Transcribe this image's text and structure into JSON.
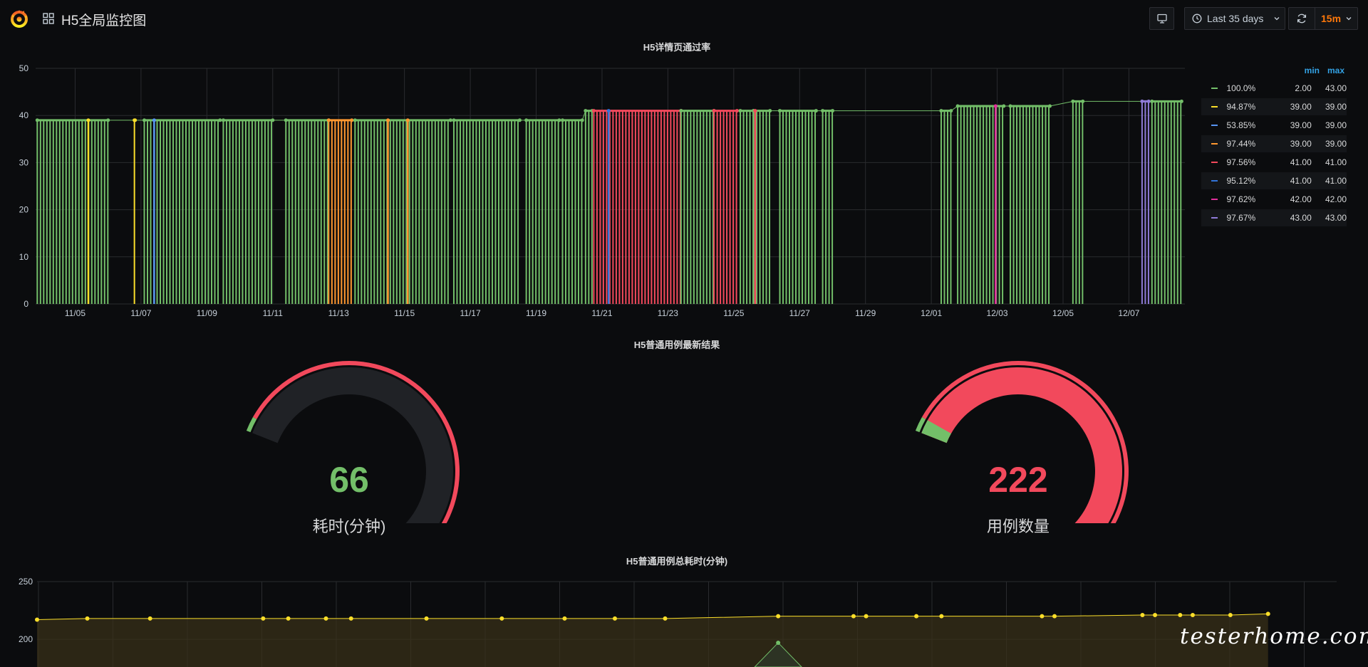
{
  "dashboard": {
    "title": "H5全局监控图"
  },
  "toolbar": {
    "time_range_label": "Last 35 days",
    "refresh_interval": "15m"
  },
  "panels": {
    "pass_rate": {
      "title": "H5详情页通过率",
      "legend": {
        "col_min": "min",
        "col_max": "max",
        "rows": [
          {
            "name": "100.0%",
            "min": "2.00",
            "max": "43.00",
            "color": "#73bf69"
          },
          {
            "name": "94.87%",
            "min": "39.00",
            "max": "39.00",
            "color": "#fade2a"
          },
          {
            "name": "53.85%",
            "min": "39.00",
            "max": "39.00",
            "color": "#5794f2"
          },
          {
            "name": "97.44%",
            "min": "39.00",
            "max": "39.00",
            "color": "#ff9830"
          },
          {
            "name": "97.56%",
            "min": "41.00",
            "max": "41.00",
            "color": "#f2495c"
          },
          {
            "name": "95.12%",
            "min": "41.00",
            "max": "41.00",
            "color": "#3274d9"
          },
          {
            "name": "97.62%",
            "min": "42.00",
            "max": "42.00",
            "color": "#e02f9b"
          },
          {
            "name": "97.67%",
            "min": "43.00",
            "max": "43.00",
            "color": "#8f7bd8"
          }
        ]
      }
    },
    "latest_result": {
      "title": "H5普通用例最新结果",
      "gauges": [
        {
          "value": "66",
          "label": "耗时(分钟)",
          "color": "#73bf69",
          "fraction": 0.05
        },
        {
          "value": "222",
          "label": "用例数量",
          "color": "#f2495c",
          "fraction": 0.97
        }
      ]
    },
    "total_time": {
      "title": "H5普通用例总耗时(分钟)"
    }
  },
  "chart_data": [
    {
      "type": "bar",
      "title": "H5详情页通过率",
      "ylim": [
        0,
        50
      ],
      "yticks": [
        0,
        10,
        20,
        30,
        40,
        50
      ],
      "xticks": [
        "11/05",
        "11/07",
        "11/09",
        "11/11",
        "11/13",
        "11/15",
        "11/17",
        "11/19",
        "11/21",
        "11/23",
        "11/25",
        "11/27",
        "11/29",
        "12/01",
        "12/03",
        "12/05",
        "12/07"
      ],
      "x_start_day": 3.8,
      "x_end_day": 38.7,
      "grid": true,
      "legend_placement": "right",
      "segments": [
        {
          "from": 3.85,
          "to": 6.0,
          "value": 39,
          "series": "100.0%"
        },
        {
          "from": 6.8,
          "to": 6.82,
          "value": 39,
          "series": "94.87%"
        },
        {
          "from": 7.1,
          "to": 9.4,
          "value": 39,
          "series": "100.0%"
        },
        {
          "from": 9.5,
          "to": 11.0,
          "value": 39,
          "series": "100.0%"
        },
        {
          "from": 11.4,
          "to": 12.7,
          "value": 39,
          "series": "100.0%"
        },
        {
          "from": 12.7,
          "to": 13.4,
          "value": 39,
          "series": "97.44%"
        },
        {
          "from": 13.5,
          "to": 16.4,
          "value": 39,
          "series": "100.0%"
        },
        {
          "from": 16.5,
          "to": 18.5,
          "value": 39,
          "series": "100.0%"
        },
        {
          "from": 18.7,
          "to": 19.7,
          "value": 39,
          "series": "100.0%"
        },
        {
          "from": 19.8,
          "to": 20.4,
          "value": 39,
          "series": "100.0%"
        },
        {
          "from": 20.5,
          "to": 20.7,
          "value": 41,
          "series": "100.0%"
        },
        {
          "from": 20.75,
          "to": 23.4,
          "value": 41,
          "series": "97.56%"
        },
        {
          "from": 23.4,
          "to": 24.4,
          "value": 41,
          "series": "100.0%"
        },
        {
          "from": 24.4,
          "to": 25.1,
          "value": 41,
          "series": "97.56%"
        },
        {
          "from": 25.2,
          "to": 25.6,
          "value": 41,
          "series": "100.0%"
        },
        {
          "from": 25.6,
          "to": 26.1,
          "value": 41,
          "series": "100.0%"
        },
        {
          "from": 26.4,
          "to": 27.5,
          "value": 41,
          "series": "100.0%"
        },
        {
          "from": 27.7,
          "to": 28.0,
          "value": 41,
          "series": "100.0%"
        },
        {
          "from": 31.3,
          "to": 31.6,
          "value": 41,
          "series": "100.0%"
        },
        {
          "from": 31.8,
          "to": 33.2,
          "value": 42,
          "series": "100.0%"
        },
        {
          "from": 33.4,
          "to": 34.6,
          "value": 42,
          "series": "100.0%"
        },
        {
          "from": 35.3,
          "to": 35.6,
          "value": 43,
          "series": "100.0%"
        },
        {
          "from": 37.4,
          "to": 37.6,
          "value": 43,
          "series": "97.67%"
        },
        {
          "from": 37.7,
          "to": 38.6,
          "value": 43,
          "series": "100.0%"
        }
      ],
      "markers": [
        {
          "day": 7.4,
          "value": 39,
          "series": "53.85%"
        },
        {
          "day": 5.4,
          "value": 39,
          "series": "94.87%"
        },
        {
          "day": 14.5,
          "value": 39,
          "series": "97.44%"
        },
        {
          "day": 15.1,
          "value": 39,
          "series": "97.44%"
        },
        {
          "day": 21.2,
          "value": 41,
          "series": "95.12%"
        },
        {
          "day": 25.65,
          "value": 41,
          "series": "97.56%"
        },
        {
          "day": 32.95,
          "value": 42,
          "series": "97.62%"
        }
      ]
    },
    {
      "type": "gauge",
      "title": "H5普通用例最新结果",
      "series": [
        {
          "name": "耗时(分钟)",
          "value": 66
        },
        {
          "name": "用例数量",
          "value": 222
        }
      ]
    },
    {
      "type": "line",
      "title": "H5普通用例总耗时(分钟)",
      "yticks": [
        200,
        250
      ],
      "ylim": [
        176,
        250
      ],
      "x_range": [
        0,
        1
      ],
      "series": [
        {
          "x": [
            0.0,
            0.04,
            0.09,
            0.18,
            0.2,
            0.23,
            0.25,
            0.31,
            0.37,
            0.42,
            0.46,
            0.5,
            0.59,
            0.65,
            0.66,
            0.7,
            0.72,
            0.8,
            0.81,
            0.88,
            0.89,
            0.91,
            0.92,
            0.95,
            0.98
          ],
          "values": [
            217,
            218,
            218,
            218,
            218,
            218,
            218,
            218,
            218,
            218,
            218,
            218,
            220,
            220,
            220,
            220,
            220,
            220,
            220,
            221,
            221,
            221,
            221,
            221,
            222
          ]
        }
      ],
      "annotation_point": {
        "x": 0.59,
        "value": 197
      }
    }
  ]
}
